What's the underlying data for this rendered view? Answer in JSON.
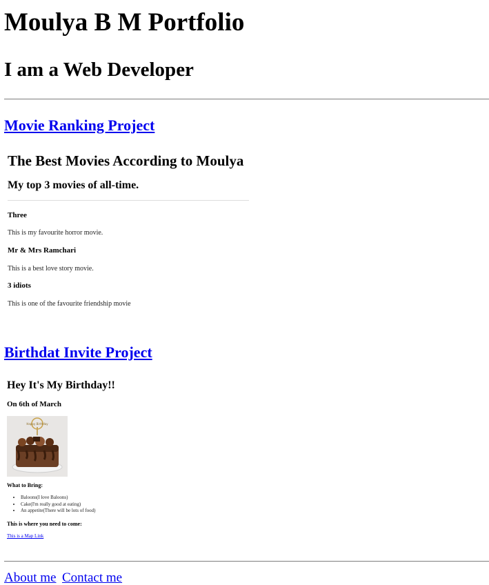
{
  "header": {
    "title": "Moulya B M Portfolio",
    "subtitle": "I am a Web Developer"
  },
  "movie_project": {
    "link_text": "Movie Ranking Project",
    "title": "The Best Movies According to Moulya",
    "subtitle": "My top 3 movies of all-time.",
    "movies": [
      {
        "name": "Three",
        "description": "This is my favourite horror movie."
      },
      {
        "name": "Mr & Mrs Ramchari",
        "description": "This is a best love story movie."
      },
      {
        "name": "3 idiots",
        "description": "This is one of the favourite friendship movie"
      }
    ]
  },
  "birthday_project": {
    "link_text": "Birthdat Invite Project",
    "title": "Hey It's My Birthday!!",
    "date": "On 6th of March",
    "cake_sign": "Happy Birthday",
    "bring_heading": "What to Bring:",
    "bring_items": [
      "Baloons(I love Baloons)",
      "Cake(I'm really good at eating)",
      "An appetite(There will be lots of food)"
    ],
    "where_heading": "This is where you need to come:",
    "map_link": "This is a Map Link"
  },
  "footer": {
    "about": "About me",
    "contact": "Contact me"
  },
  "colors": {
    "link": "#0000ee",
    "text": "#000000",
    "background": "#ffffff"
  }
}
